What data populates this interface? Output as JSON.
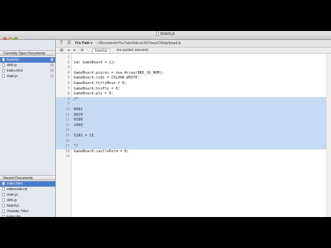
{
  "window": {
    "title": "board.js"
  },
  "sidebar": {
    "open_header": "Currently Open Documents",
    "open_docs": [
      {
        "label": "board.js",
        "selected": true
      },
      {
        "label": "defs.js",
        "selected": false
      },
      {
        "label": "index.html",
        "selected": false
      },
      {
        "label": "main.js",
        "selected": false
      }
    ],
    "recent_header": "Recent Documents",
    "recent_docs": [
      {
        "label": "index.html",
        "selected": true
      },
      {
        "label": "videocode.txt",
        "selected": false
      },
      {
        "label": "main.js",
        "selected": false
      },
      {
        "label": "defs.js",
        "selected": false
      },
      {
        "label": "board.js",
        "selected": false
      },
      {
        "label": "Youtube Titles",
        "selected": false
      },
      {
        "label": "login.php",
        "selected": false
      }
    ]
  },
  "editor": {
    "file_path_label": "File Path ▾",
    "file_path": ":~/Documents/YouTubeVideos/JSChess/Ch5/js/board.js",
    "nav_file": "board.js",
    "nav_symbol": "(no symbol selected)",
    "lines": [
      {
        "n": "1",
        "text": "",
        "hl": false
      },
      {
        "n": "2",
        "text": "var GameBoard = {};",
        "hl": false
      },
      {
        "n": "3",
        "text": "",
        "hl": false
      },
      {
        "n": "4",
        "text": "GameBoard.pieces = new Array(BRD_SQ_NUM);",
        "hl": false
      },
      {
        "n": "5",
        "text": "GameBoard.side = COLOUR.WHITE;",
        "hl": false
      },
      {
        "n": "6",
        "text": "GameBoard.fiftyMove = 0;",
        "hl": false
      },
      {
        "n": "7",
        "text": "GameBoard.hisPly = 0;",
        "hl": false
      },
      {
        "n": "8",
        "text": "GameBoard.ply = 0;",
        "hl": false
      },
      {
        "n": "9",
        "text": "/*",
        "hl": true
      },
      {
        "n": "9",
        "text": "",
        "hl": true
      },
      {
        "n": "10",
        "text": "0001",
        "hl": true
      },
      {
        "n": "11",
        "text": "0010",
        "hl": true
      },
      {
        "n": "12",
        "text": "0100",
        "hl": true
      },
      {
        "n": "13",
        "text": "1000",
        "hl": true
      },
      {
        "n": "14",
        "text": "",
        "hl": true
      },
      {
        "n": "15",
        "text": "1101 = 13",
        "hl": true
      },
      {
        "n": "16",
        "text": "",
        "hl": true
      },
      {
        "n": "17",
        "text": "*/",
        "hl": true
      },
      {
        "n": "18",
        "text": "GameBoard.castlePerm = 0;",
        "hl": false
      },
      {
        "n": "19",
        "text": "",
        "hl": false
      }
    ]
  }
}
